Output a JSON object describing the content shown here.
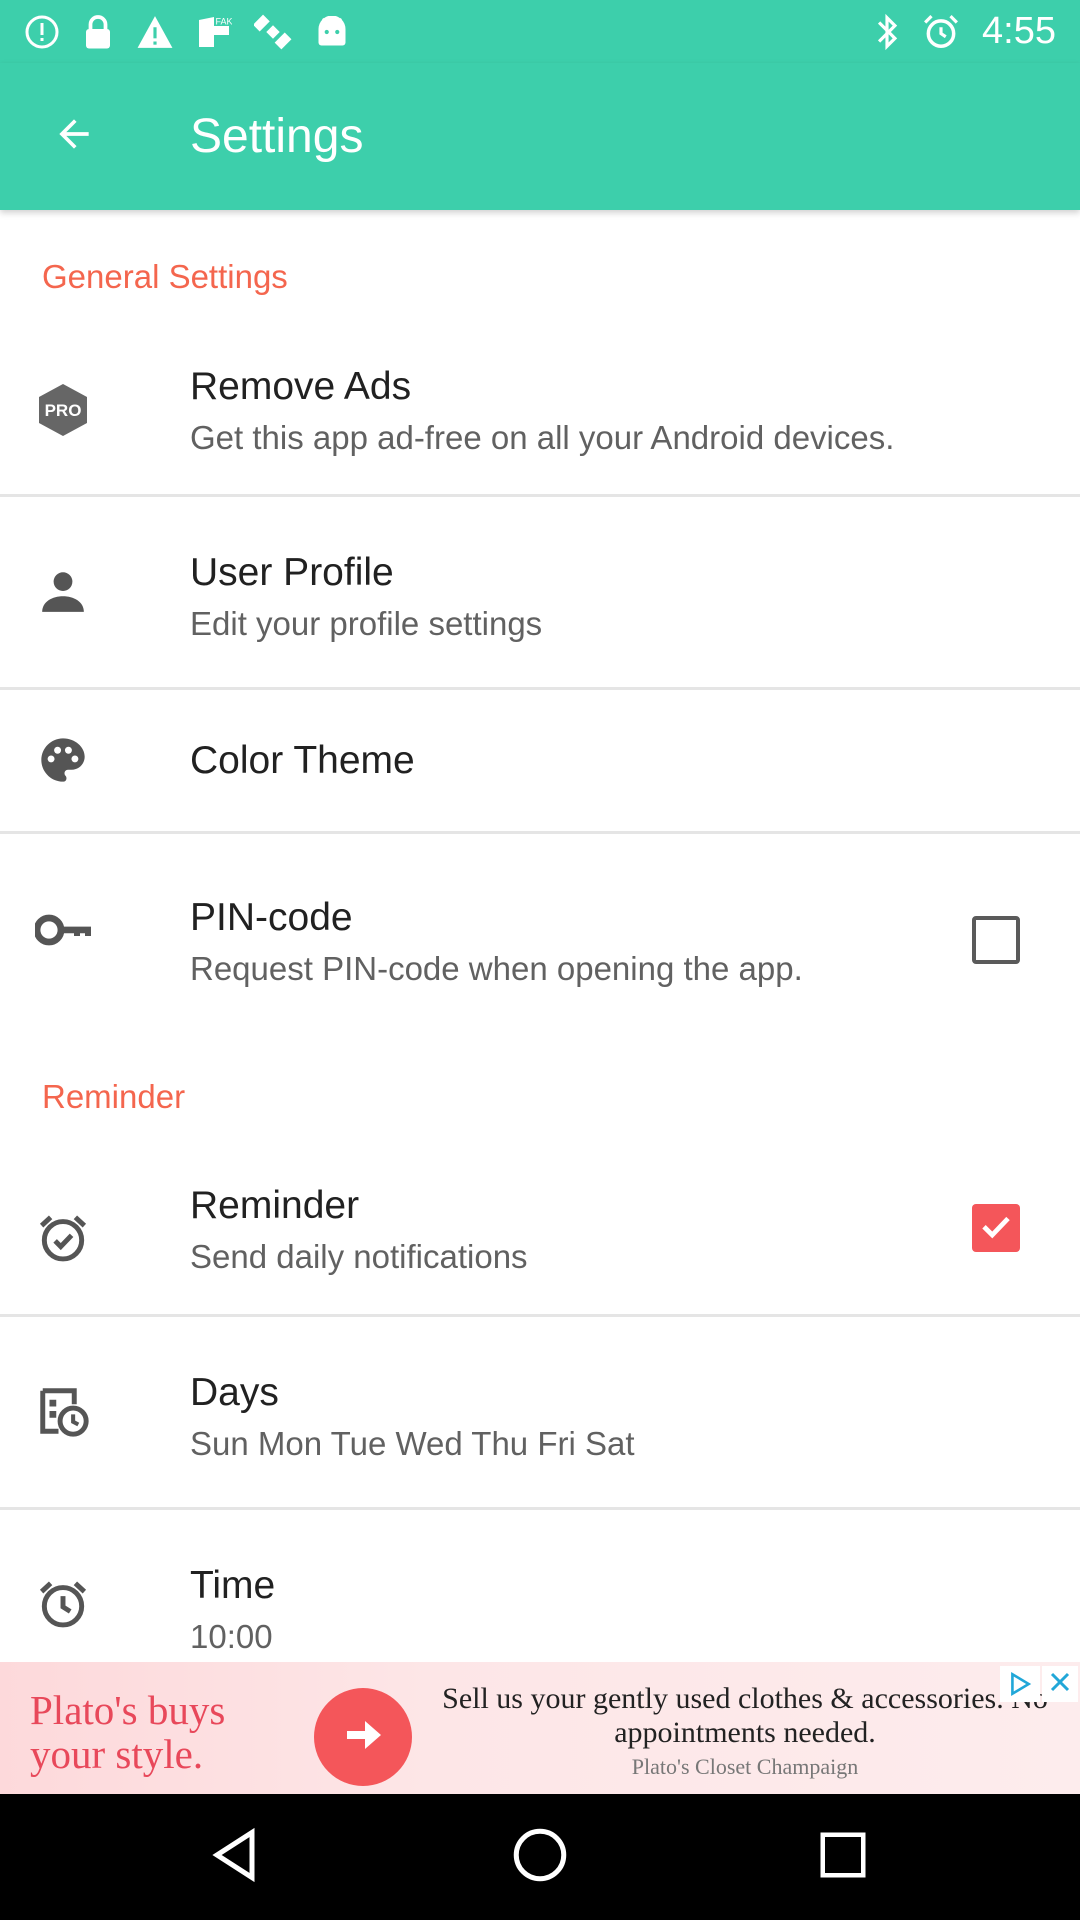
{
  "status_bar": {
    "time": "4:55",
    "icons": [
      "alert-circle-icon",
      "lock-icon",
      "warning-icon",
      "fake-gps-icon",
      "satellite-icon",
      "android-icon",
      "bluetooth-icon",
      "alarm-icon"
    ]
  },
  "app_bar": {
    "title": "Settings",
    "back_icon": "arrow-back-icon"
  },
  "sections": {
    "general": {
      "header": "General Settings"
    },
    "reminder": {
      "header": "Reminder"
    }
  },
  "items": {
    "remove_ads": {
      "title": "Remove Ads",
      "subtitle": "Get this app ad-free on all your Android devices.",
      "icon": "pro-badge-icon"
    },
    "user_profile": {
      "title": "User Profile",
      "subtitle": "Edit your profile settings",
      "icon": "person-icon"
    },
    "color_theme": {
      "title": "Color Theme",
      "icon": "palette-icon"
    },
    "pin_code": {
      "title": "PIN-code",
      "subtitle": "Request PIN-code when opening the app.",
      "icon": "key-icon",
      "checked": false
    },
    "reminder": {
      "title": "Reminder",
      "subtitle": "Send daily notifications",
      "icon": "alarm-check-icon",
      "checked": true
    },
    "days": {
      "title": "Days",
      "subtitle": "Sun Mon Tue Wed Thu Fri Sat",
      "icon": "calendar-clock-icon"
    },
    "time": {
      "title": "Time",
      "subtitle": "10:00",
      "icon": "clock-icon"
    }
  },
  "ad": {
    "headline": "Plato's buys your style.",
    "body": "Sell us your gently used clothes & accessories. No appointments needed.",
    "source": "Plato's Closet Champaign"
  },
  "colors": {
    "primary": "#3dcfab",
    "accent": "#f4664e",
    "checkbox_on": "#f4565a",
    "text_primary": "#212121",
    "text_secondary": "#616161"
  },
  "nav_bar": {
    "buttons": [
      "back-icon",
      "home-icon",
      "recents-icon"
    ]
  }
}
